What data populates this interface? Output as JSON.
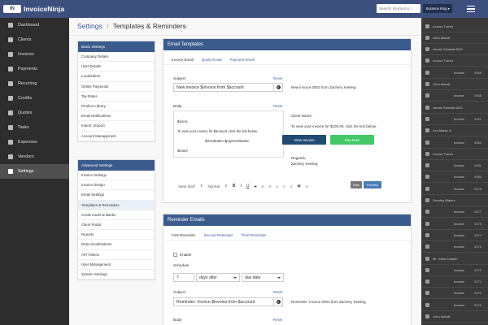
{
  "app": {
    "brand": "InvoiceNinja",
    "logo_text": "IN"
  },
  "topbar": {
    "search_placeholder": "Search: shortcut is /",
    "user_button": "Suzanne King ▾"
  },
  "sidebar": {
    "items": [
      {
        "label": "Dashboard",
        "icon": "dashboard-icon"
      },
      {
        "label": "Clients",
        "icon": "users-icon"
      },
      {
        "label": "Invoices",
        "icon": "file-icon"
      },
      {
        "label": "Payments",
        "icon": "credit-card-icon"
      },
      {
        "label": "Recurring",
        "icon": "files-icon"
      },
      {
        "label": "Credits",
        "icon": "credit-icon"
      },
      {
        "label": "Quotes",
        "icon": "quote-icon"
      },
      {
        "label": "Tasks",
        "icon": "clock-icon"
      },
      {
        "label": "Expenses",
        "icon": "expense-icon"
      },
      {
        "label": "Vendors",
        "icon": "building-icon"
      },
      {
        "label": "Settings",
        "icon": "gear-icon",
        "active": true
      }
    ]
  },
  "breadcrumb": {
    "root": "Settings",
    "sep": "/",
    "current": "Templates & Reminders"
  },
  "basic_nav": {
    "header": "Basic Settings",
    "items": [
      "Company Details",
      "User Details",
      "Localization",
      "Online Payments",
      "Tax Rates",
      "Product Library",
      "Email Notifications",
      "Import | Export",
      "Account Management"
    ]
  },
  "advanced_nav": {
    "header": "Advanced Settings",
    "items": [
      "Invoice Settings",
      "Invoice Design",
      "Email Settings",
      "Templates & Reminders",
      "Credit Cards & Banks",
      "Client Portal",
      "Reports",
      "Data Visualizations",
      "API Tokens",
      "User Management",
      "System Settings"
    ],
    "active_index": 3
  },
  "email_templates": {
    "header": "Email Templates",
    "tabs": [
      "Invoice Email",
      "Quote Email",
      "Payment Email"
    ],
    "subject_label": "Subject",
    "reset": "Reset",
    "subject_value": "New invoice $invoice from $account",
    "subject_preview": "New invoice 0001 from Zachery Keeling",
    "body_label": "Body",
    "body_lines": [
      "$client,",
      "To view your invoice for $amount, click the link below.",
      "$viewButton $paymentButton",
      "$footer"
    ],
    "preview_client": "Client Name,",
    "preview_text": "To view your invoice for $100.00, click the link below.",
    "view_button": "View Invoice",
    "pay_button": "Pay Now",
    "regards": "Regards,",
    "signature": "Zachery Keeling",
    "toolbar": {
      "font": "Sans Serif",
      "size": "Normal"
    },
    "raw_button": "Raw",
    "preview_button": "Preview"
  },
  "reminder_emails": {
    "header": "Reminder Emails",
    "tabs": [
      "First Reminder",
      "Second Reminder",
      "Third Reminder"
    ],
    "enable_label": "Enable",
    "schedule_label": "Schedule",
    "schedule_days": "7",
    "schedule_direction": "days after",
    "schedule_field": "due date",
    "subject_label": "Subject",
    "reset": "Reset",
    "subject_value": "Reminder: Invoice $invoice from $account",
    "subject_preview": "Reminder: Invoice 0001 from Zachery Keeling",
    "body_label": "Body"
  },
  "right_sidebar": {
    "rows": [
      {
        "type": "client",
        "text": "Leonor Turner"
      },
      {
        "type": "item",
        "text": "John Abbott"
      },
      {
        "type": "item",
        "text": "Jennie Schmidt DDS"
      },
      {
        "type": "client",
        "text": "Leonor Turner"
      },
      {
        "type": "invoice",
        "text": "Invoice",
        "num": "0069"
      },
      {
        "type": "client",
        "text": "John Abbott"
      },
      {
        "type": "invoice",
        "text": "Invoice",
        "num": "0068"
      },
      {
        "type": "client",
        "text": "Jennie Schmidt DDS"
      },
      {
        "type": "invoice",
        "text": "Invoice",
        "num": "0021"
      },
      {
        "type": "client",
        "text": "Leo Marks Jr."
      },
      {
        "type": "invoice",
        "text": "Invoice",
        "num": "0062"
      },
      {
        "type": "client",
        "text": "Leonor Turner"
      },
      {
        "type": "invoice",
        "text": "Invoice",
        "num": "0081"
      },
      {
        "type": "invoice",
        "text": "Invoice",
        "num": "0080"
      },
      {
        "type": "invoice",
        "text": "Invoice",
        "num": "0076"
      },
      {
        "type": "client",
        "text": "Dorothy Waters"
      },
      {
        "type": "invoice",
        "text": "Invoice",
        "num": "0077"
      },
      {
        "type": "invoice",
        "text": "Invoice",
        "num": "0075"
      },
      {
        "type": "invoice",
        "text": "Invoice",
        "num": "0074"
      },
      {
        "type": "invoice",
        "text": "Invoice",
        "num": "0073"
      },
      {
        "type": "client",
        "text": "Mr. Jules Koelpin"
      },
      {
        "type": "invoice",
        "text": "Invoice",
        "num": "0072"
      },
      {
        "type": "invoice",
        "text": "Invoice",
        "num": "0071"
      },
      {
        "type": "invoice",
        "text": "Invoice",
        "num": "0071"
      },
      {
        "type": "invoice",
        "text": "Invoice",
        "num": "0070"
      },
      {
        "type": "client",
        "text": "John Abbott"
      }
    ]
  },
  "colors": {
    "topbar": "#3c4f7d",
    "panel_header": "#3a5b8c",
    "view_button": "#1f4a72",
    "pay_button": "#44c767",
    "sidebar": "#2d2d2d"
  }
}
